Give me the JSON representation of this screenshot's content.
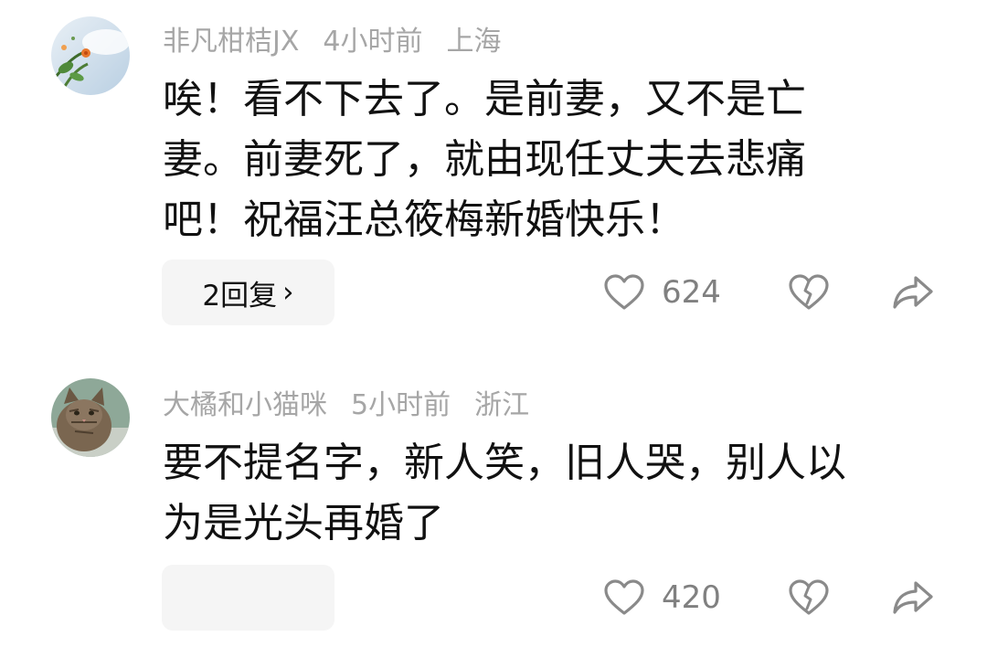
{
  "comments": [
    {
      "author": "非凡柑桔JX",
      "time": "4小时前",
      "location": "上海",
      "text": "唉！看不下去了。是前妻，又不是亡妻。前妻死了，就由现任丈夫去悲痛吧！祝福汪总筱梅新婚快乐！",
      "reply_label": "2回复",
      "reply_chevron": "›",
      "likes": "624"
    },
    {
      "author": "大橘和小猫咪",
      "time": "5小时前",
      "location": "浙江",
      "text": "要不提名字，新人笑，旧人哭，别人以为是光头再婚了",
      "likes": "420"
    }
  ],
  "icons": {
    "like": "heart-outline-icon",
    "dislike": "broken-heart-icon",
    "share": "share-arrow-icon"
  },
  "colors": {
    "meta_text": "#a6a6a6",
    "body_text": "#111111",
    "count_text": "#808080",
    "icon_stroke": "#8a8a8a",
    "pill_bg": "#f5f5f5"
  }
}
